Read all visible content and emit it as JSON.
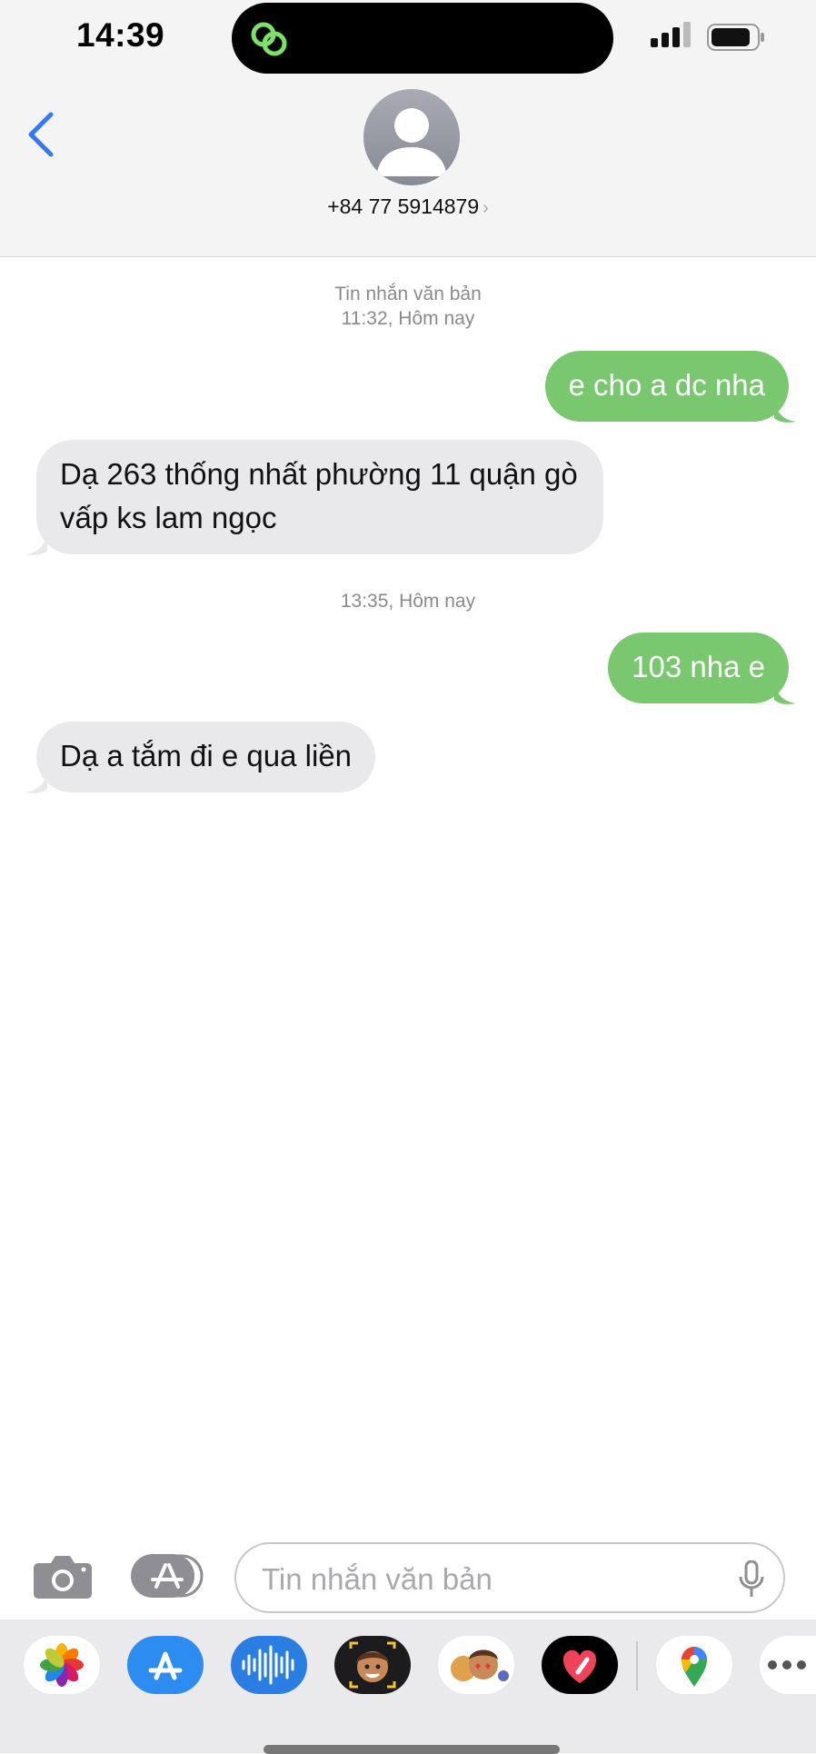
{
  "status_bar": {
    "time": "14:39"
  },
  "header": {
    "contact": "+84 77 5914879",
    "chevron": "›"
  },
  "thread": {
    "meta_1_line1": "Tin nhắn văn bản",
    "meta_1_line2": "11:32, Hôm nay",
    "msg_1": "e cho a dc nha",
    "msg_2": "Dạ 263 thống nhất phường 11 quận gò vấp ks lam ngọc",
    "meta_2": "13:35, Hôm nay",
    "msg_3": "103 nha e",
    "msg_4": "Dạ a tắm đi e qua liền"
  },
  "composer": {
    "placeholder": "Tin nhắn văn bản"
  },
  "drawer": {
    "apps": [
      "photos-icon",
      "app-store-icon",
      "audio-message-icon",
      "memoji-icon",
      "memoji-stickers-icon",
      "digital-touch-icon",
      "google-maps-icon",
      "more-icon"
    ]
  },
  "colors": {
    "outgoing": "#79c86f",
    "incoming": "#e9e9eb",
    "accent": "#3478f6"
  }
}
